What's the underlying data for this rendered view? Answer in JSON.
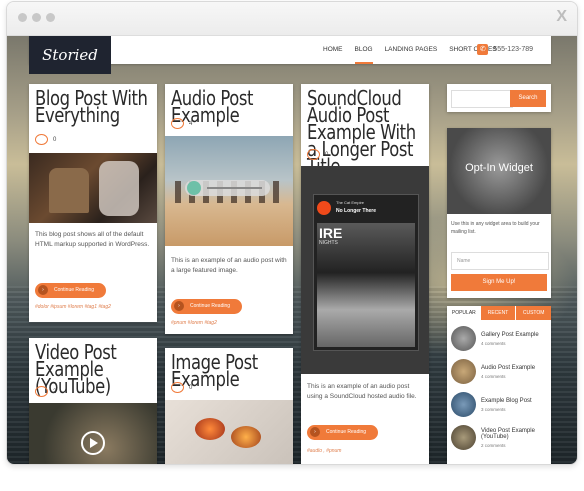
{
  "browser": {
    "close_glyph": "X"
  },
  "header": {
    "logo_text": "Storied",
    "nav": [
      {
        "label": "HOME",
        "active": false
      },
      {
        "label": "BLOG",
        "active": true
      },
      {
        "label": "LANDING PAGES",
        "active": false
      },
      {
        "label": "SHORT CODES",
        "active": false
      }
    ],
    "phone": "555-123-789"
  },
  "posts": {
    "blog_everything": {
      "title": "Blog Post With Everything",
      "comments": "0",
      "excerpt": "This blog post shows all of the default HTML markup supported in WordPress.",
      "button": "Continue Reading",
      "tags": "#dolor #ipsum #lorem #tag1 #tag2"
    },
    "video_youtube": {
      "title": "Video Post Example (YouTube)",
      "comments": "2"
    },
    "audio_post": {
      "title": "Audio Post Example",
      "comments": "4",
      "excerpt": "This is an example of an audio post with a large featured image.",
      "button": "Continue Reading",
      "tags": "#pnum #lorem #tag2"
    },
    "image_post": {
      "title": "Image Post Example",
      "comments": "0"
    },
    "soundcloud_post": {
      "title": "SoundCloud Audio Post Example With a Longer Post Title",
      "comments": "0",
      "player_artist": "The Cat Empire",
      "player_track": "No Longer There",
      "player_art_text": "IRE",
      "player_art_sub": "NIGHTS",
      "excerpt": "This is an example of an audio post using a SoundCloud hosted audio file.",
      "button": "Continue Reading",
      "tags": "#audio , #pnum"
    }
  },
  "sidebar": {
    "search_button": "Search",
    "optin": {
      "title": "Opt-In Widget",
      "text": "Use this in any widget area to build your mailing list.",
      "name_placeholder": "Name",
      "button": "Sign Me Up!"
    },
    "tabs": [
      {
        "label": "POPULAR",
        "active": true
      },
      {
        "label": "RECENT",
        "active": false
      },
      {
        "label": "CUSTOM",
        "active": false
      }
    ],
    "popular": [
      {
        "title": "Gallery Post Example",
        "meta": "4 comments"
      },
      {
        "title": "Audio Post Example",
        "meta": "4 comments"
      },
      {
        "title": "Example Blog Post",
        "meta": "3 comments"
      },
      {
        "title": "Video Post Example (YouTube)",
        "meta": "2 comments"
      }
    ]
  },
  "colors": {
    "accent": "#f07a3a",
    "logo_bg": "#1f2430"
  }
}
